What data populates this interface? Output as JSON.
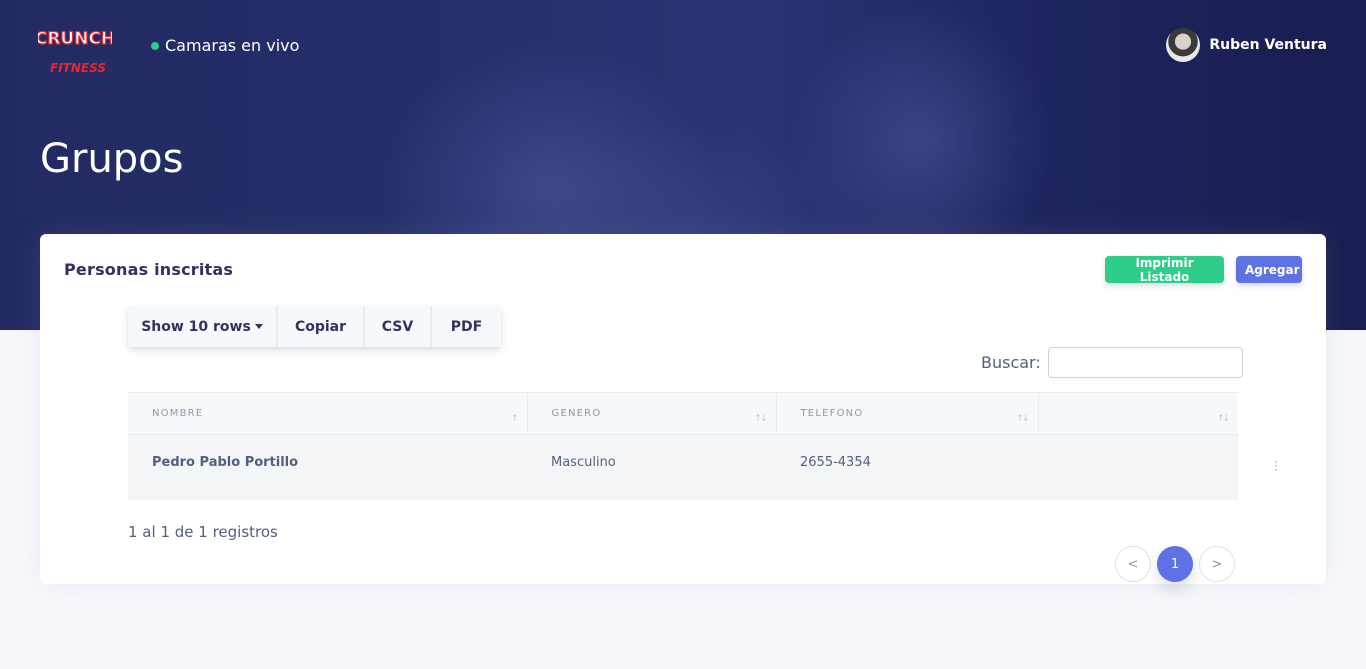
{
  "brand": {
    "logo_text_top": "CRUNCH",
    "logo_text_bottom": "FITNESS",
    "accent": "#e8262d"
  },
  "nav": {
    "live_label": "Camaras en vivo",
    "live_status_color": "#2dce89"
  },
  "user": {
    "name": "Ruben Ventura"
  },
  "page": {
    "title": "Grupos"
  },
  "card": {
    "title": "Personas inscritas",
    "print_label": "Imprimir Listado",
    "add_label": "Agregar"
  },
  "toolbar": {
    "show_label": "Show 10 rows",
    "copy_label": "Copiar",
    "csv_label": "CSV",
    "pdf_label": "PDF"
  },
  "search": {
    "label": "Buscar:",
    "value": ""
  },
  "table": {
    "columns": [
      "NOMBRE",
      "GENERO",
      "TELEFONO",
      ""
    ],
    "rows": [
      {
        "nombre": "Pedro Pablo Portillo",
        "genero": "Masculino",
        "telefono": "2655-4354"
      }
    ]
  },
  "footer": {
    "info": "1 al 1 de 1 registros"
  },
  "pagination": {
    "prev": "<",
    "current": "1",
    "next": ">"
  },
  "colors": {
    "primary": "#5e72e4",
    "success": "#2dce89",
    "hero": "#232a63"
  }
}
